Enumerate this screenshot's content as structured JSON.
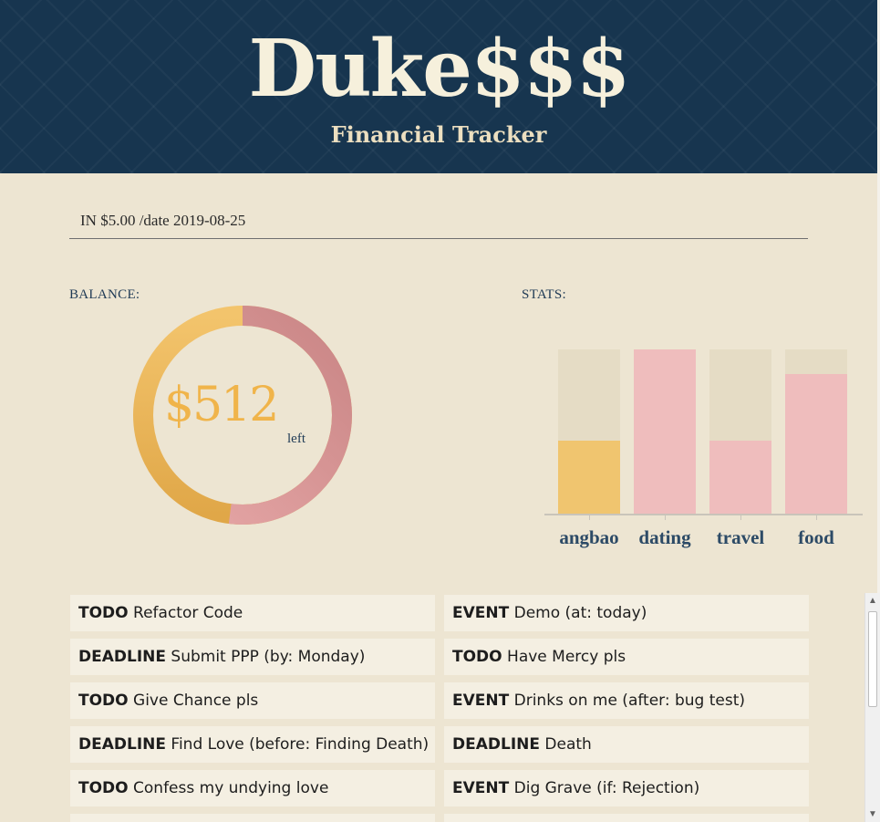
{
  "header": {
    "title": "Duke$$$",
    "subtitle": "Financial Tracker"
  },
  "command": {
    "value": "IN $5.00 /date 2019-08-25",
    "placeholder": ""
  },
  "balance": {
    "label": "BALANCE:",
    "amount": "$512",
    "suffix": "left",
    "fraction_spent": 0.52
  },
  "stats": {
    "label": "STATS:"
  },
  "chart_data": {
    "type": "bar",
    "categories": [
      "angbao",
      "dating",
      "travel",
      "food"
    ],
    "values": [
      0.45,
      1.0,
      0.45,
      0.85
    ],
    "ylim": [
      0,
      1
    ],
    "grid": false,
    "colors": [
      "#f0c56f",
      "#efbdbd",
      "#efbdbd",
      "#efbdbd"
    ]
  },
  "tasks": [
    {
      "type": "TODO",
      "desc": "Refactor Code"
    },
    {
      "type": "EVENT",
      "desc": "Demo (at: today)"
    },
    {
      "type": "DEADLINE",
      "desc": "Submit PPP (by: Monday)"
    },
    {
      "type": "TODO",
      "desc": "Have Mercy pls"
    },
    {
      "type": "TODO",
      "desc": "Give Chance pls"
    },
    {
      "type": "EVENT",
      "desc": "Drinks on me (after: bug test)"
    },
    {
      "type": "DEADLINE",
      "desc": "Find Love (before: Finding Death)"
    },
    {
      "type": "DEADLINE",
      "desc": "Death"
    },
    {
      "type": "TODO",
      "desc": "Confess my undying love"
    },
    {
      "type": "EVENT",
      "desc": "Dig Grave (if: Rejection)"
    }
  ],
  "colors": {
    "header_bg": "#17354f",
    "page_bg": "#ede5d2",
    "accent_gold": "#f0b44a",
    "accent_pink": "#d18d8d"
  }
}
